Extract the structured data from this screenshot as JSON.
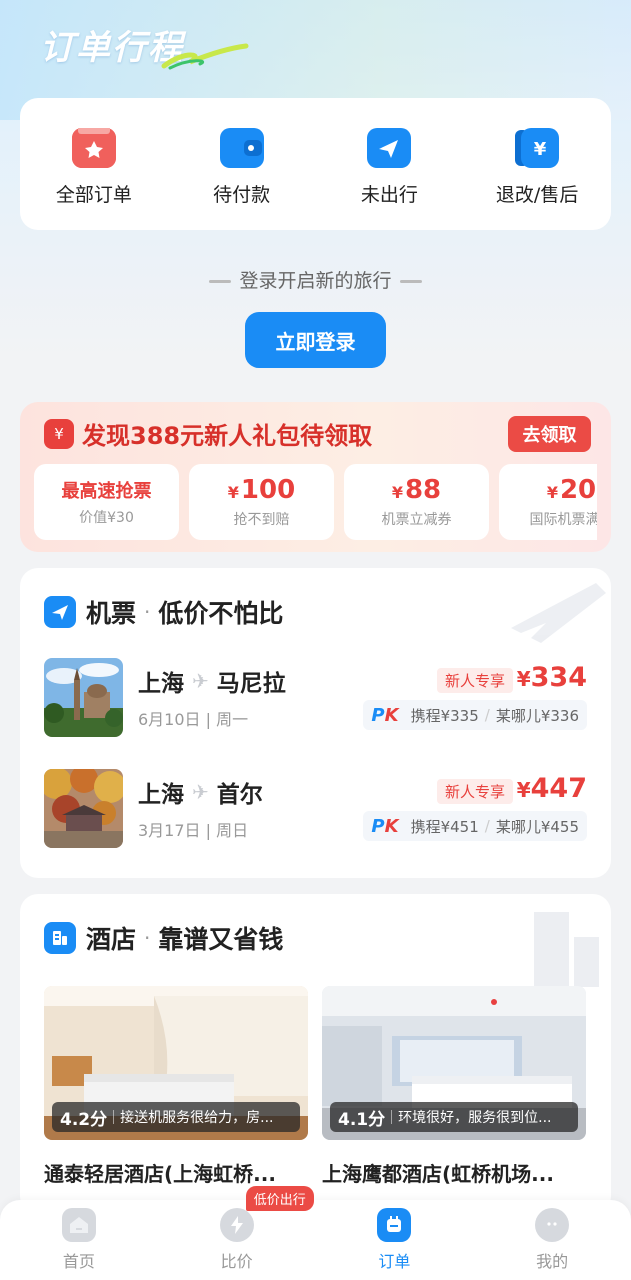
{
  "header": {
    "title": "订单行程"
  },
  "orders": [
    {
      "label": "全部订单",
      "icon": "folder-icon",
      "color": "#f0605c"
    },
    {
      "label": "待付款",
      "icon": "wallet-icon",
      "color": "#1a8cf5"
    },
    {
      "label": "未出行",
      "icon": "send-icon",
      "color": "#1a8cf5"
    },
    {
      "label": "退改/售后",
      "icon": "yen-receipt-icon",
      "color": "#1a8cf5"
    }
  ],
  "login": {
    "hint": "登录开启新的旅行",
    "button": "立即登录"
  },
  "promo": {
    "badge": "¥",
    "title": "发现388元新人礼包待领取",
    "button": "去领取",
    "coupons": [
      {
        "main": "最高速抢票",
        "yen": "",
        "sub": "价值¥30"
      },
      {
        "main": "100",
        "yen": "¥",
        "sub": "抢不到赔"
      },
      {
        "main": "88",
        "yen": "¥",
        "sub": "机票立减券"
      },
      {
        "main": "20",
        "yen": "¥",
        "sub": "国际机票满减"
      }
    ]
  },
  "flights": {
    "title": "机票",
    "dot": "·",
    "subtitle": "低价不怕比",
    "items": [
      {
        "from": "上海",
        "to": "马尼拉",
        "date": "6月10日 | 周一",
        "tag": "新人专享",
        "yen": "¥",
        "price": "334",
        "pk_p": "P",
        "pk_k": "K",
        "ctrip": "携程¥335",
        "qunar": "某哪儿¥336"
      },
      {
        "from": "上海",
        "to": "首尔",
        "date": "3月17日 | 周日",
        "tag": "新人专享",
        "yen": "¥",
        "price": "447",
        "pk_p": "P",
        "pk_k": "K",
        "ctrip": "携程¥451",
        "qunar": "某哪儿¥455"
      }
    ]
  },
  "hotels": {
    "title": "酒店",
    "dot": "·",
    "subtitle": "靠谱又省钱",
    "items": [
      {
        "score": "4.2分",
        "review": "接送机服务很给力，房...",
        "name": "通泰轻居酒店(上海虹桥..."
      },
      {
        "score": "4.1分",
        "review": "环境很好，服务很到位...",
        "name": "上海鹰都酒店(虹桥机场..."
      }
    ]
  },
  "nav": {
    "items": [
      {
        "label": "首页",
        "icon": "home-icon"
      },
      {
        "label": "比价",
        "icon": "lightning-icon",
        "tag": "低价出行"
      },
      {
        "label": "订单",
        "icon": "order-icon",
        "active": true
      },
      {
        "label": "我的",
        "icon": "profile-icon"
      }
    ]
  }
}
